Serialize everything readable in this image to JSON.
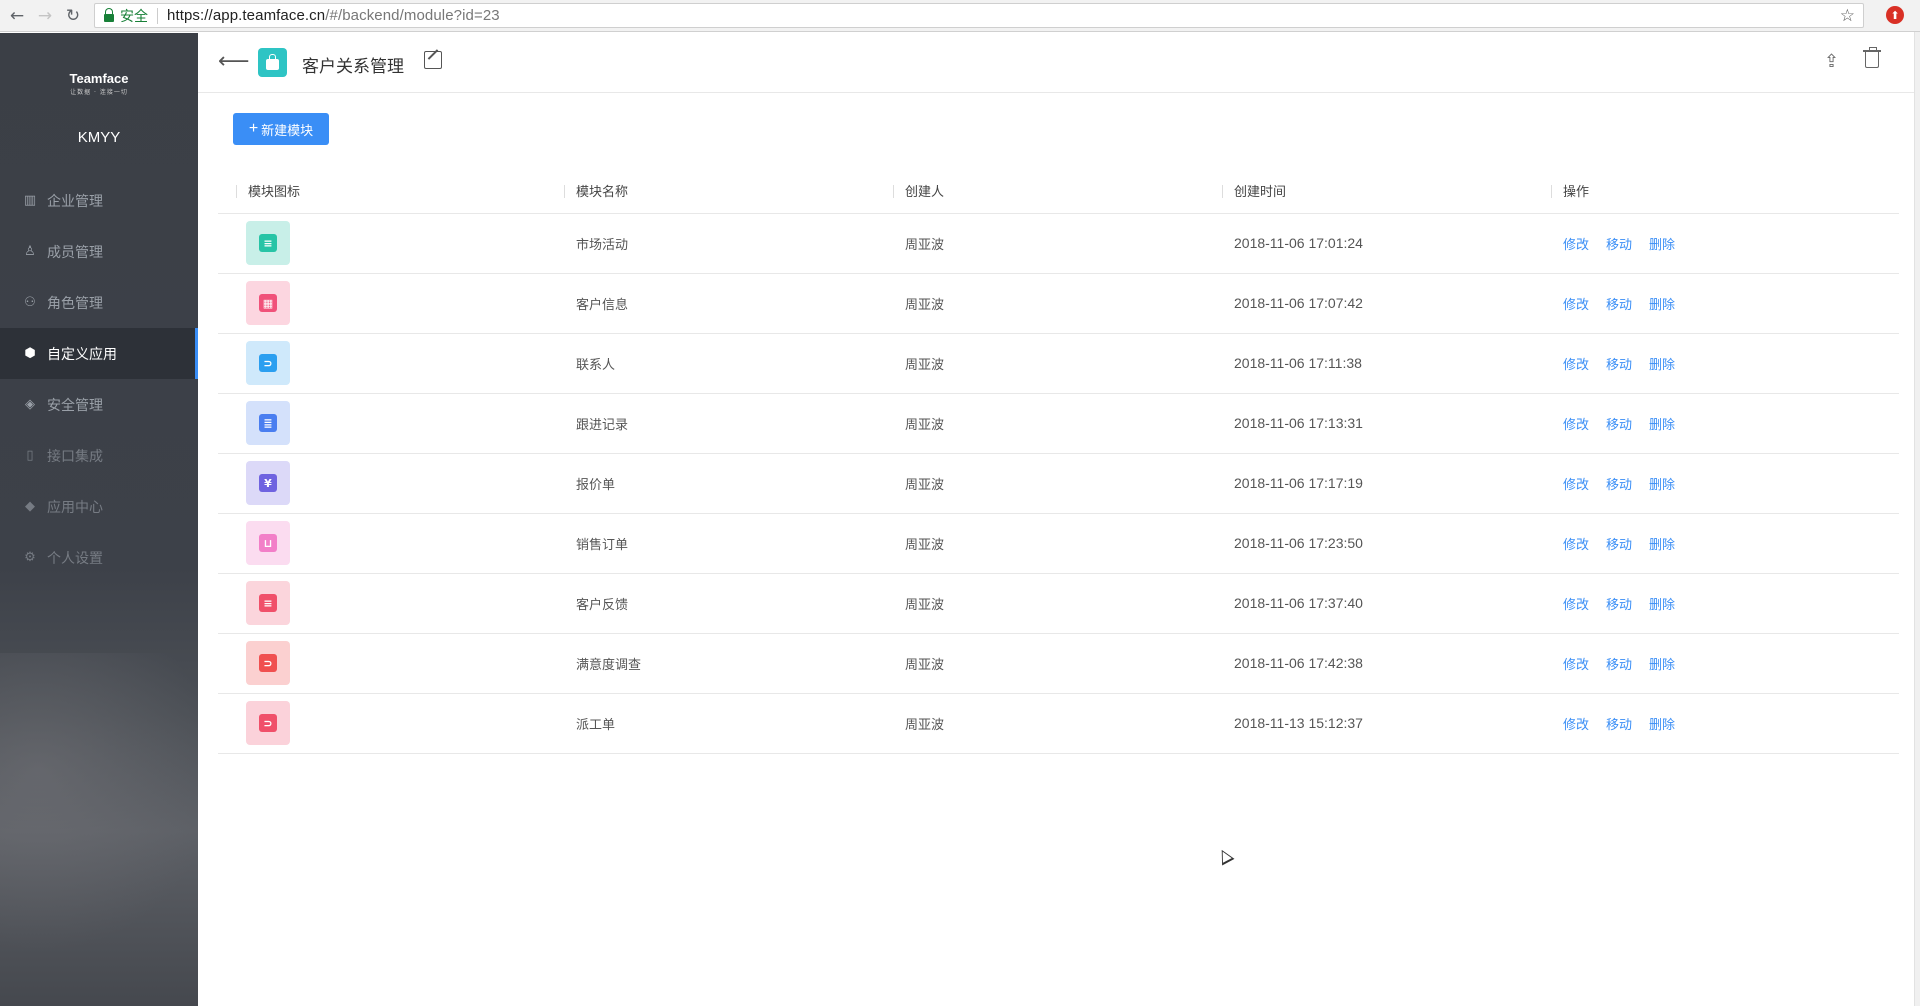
{
  "browser": {
    "secure_label": "安全",
    "url_host": "https://app.teamface.cn",
    "url_path": "/#/backend/module?id=23"
  },
  "sidebar": {
    "brand_name": "Teamface",
    "brand_slogan": "让数据 · 连接一切",
    "company": "KMYY",
    "items": [
      {
        "label": "企业管理",
        "icon": "chart-bars-icon"
      },
      {
        "label": "成员管理",
        "icon": "user-icon"
      },
      {
        "label": "角色管理",
        "icon": "users-icon"
      },
      {
        "label": "自定义应用",
        "icon": "cube-icon",
        "active": true
      },
      {
        "label": "安全管理",
        "icon": "shield-icon"
      },
      {
        "label": "接口集成",
        "icon": "plug-icon"
      },
      {
        "label": "应用中心",
        "icon": "box-icon"
      },
      {
        "label": "个人设置",
        "icon": "gear-icon"
      }
    ]
  },
  "header": {
    "title": "客户关系管理"
  },
  "toolbar": {
    "new_module_label": "新建模块"
  },
  "table": {
    "columns": [
      "模块图标",
      "模块名称",
      "创建人",
      "创建时间",
      "操作"
    ],
    "actions": [
      "修改",
      "移动",
      "删除"
    ],
    "rows": [
      {
        "name": "市场活动",
        "creator": "周亚波",
        "time": "2018-11-06 17:01:24",
        "icon_bg": "#c8efe8",
        "icon_fg": "#27c4a6",
        "icon": "list-doc-icon"
      },
      {
        "name": "客户信息",
        "creator": "周亚波",
        "time": "2018-11-06 17:07:42",
        "icon_bg": "#fcd6e0",
        "icon_fg": "#f0527a",
        "icon": "calendar-icon"
      },
      {
        "name": "联系人",
        "creator": "周亚波",
        "time": "2018-11-06 17:11:38",
        "icon_bg": "#cfe9fb",
        "icon_fg": "#2b9ff0",
        "icon": "folder-icon"
      },
      {
        "name": "跟进记录",
        "creator": "周亚波",
        "time": "2018-11-06 17:13:31",
        "icon_bg": "#d4e1fb",
        "icon_fg": "#4a7ef0",
        "icon": "note-icon"
      },
      {
        "name": "报价单",
        "creator": "周亚波",
        "time": "2018-11-06 17:17:19",
        "icon_bg": "#dcd9f8",
        "icon_fg": "#6f63e0",
        "icon": "money-bag-icon"
      },
      {
        "name": "销售订单",
        "creator": "周亚波",
        "time": "2018-11-06 17:23:50",
        "icon_bg": "#fbdcf0",
        "icon_fg": "#f27fc8",
        "icon": "cart-icon"
      },
      {
        "name": "客户反馈",
        "creator": "周亚波",
        "time": "2018-11-06 17:37:40",
        "icon_bg": "#fbd5dc",
        "icon_fg": "#f0506a",
        "icon": "feedback-doc-icon"
      },
      {
        "name": "满意度调查",
        "creator": "周亚波",
        "time": "2018-11-06 17:42:38",
        "icon_bg": "#fbd0d0",
        "icon_fg": "#f05050",
        "icon": "folder-icon"
      },
      {
        "name": "派工单",
        "creator": "周亚波",
        "time": "2018-11-13 15:12:37",
        "icon_bg": "#fbd2da",
        "icon_fg": "#f0506a",
        "icon": "folder-icon"
      }
    ]
  }
}
